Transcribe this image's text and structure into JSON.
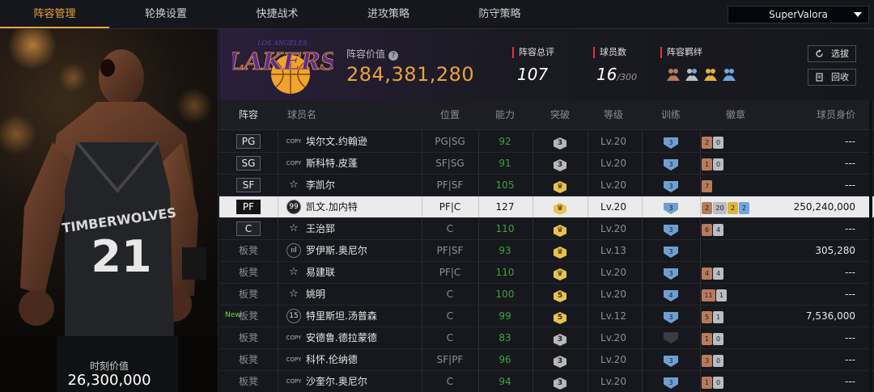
{
  "nav": {
    "tabs": [
      {
        "label": "阵容管理",
        "active": true
      },
      {
        "label": "轮换设置",
        "active": false
      },
      {
        "label": "快捷战术",
        "active": false
      },
      {
        "label": "进攻策略",
        "active": false
      },
      {
        "label": "防守策略",
        "active": false
      }
    ],
    "account": "SuperValora"
  },
  "player_panel": {
    "moment_label": "时刻价值",
    "moment_value": "26,300,000",
    "jersey_text": "TIMBERWOLVES",
    "jersey_number": "21"
  },
  "team": {
    "logo_text": "LAKERS",
    "logo_subtext": "LOS ANGELES",
    "value_label": "阵容价值",
    "value": "284,381,280",
    "rating_label": "阵容总评",
    "rating": "107",
    "count_label": "球员数",
    "count": "16",
    "count_max": "/300",
    "bond_label": "羁绊",
    "bond_label_full": "阵容羁绊",
    "buttons": {
      "select": "选拔",
      "recycle": "回收"
    }
  },
  "table": {
    "headers": {
      "lineup": "阵容",
      "name": "球员名",
      "position": "位置",
      "ability": "能力",
      "breakthrough": "突破",
      "level": "等级",
      "training": "训练",
      "badge": "徽章",
      "worth": "球员身价"
    },
    "rows": [
      {
        "slot": "PG",
        "card": "COPY",
        "name": "埃尔文.约翰逊",
        "pos": "PG|SG",
        "ability": "92",
        "bt": "3",
        "bt_color": "gray",
        "level": "Lv.20",
        "training": "3",
        "badges": [
          {
            "t": "2",
            "c": "bronze"
          },
          {
            "t": "0",
            "c": "silver"
          }
        ],
        "worth": "---",
        "new": ""
      },
      {
        "slot": "SG",
        "card": "COPY",
        "name": "斯科特.皮蓬",
        "pos": "SF|SG",
        "ability": "91",
        "bt": "3",
        "bt_color": "gray",
        "level": "Lv.20",
        "training": "3",
        "badges": [
          {
            "t": "1",
            "c": "bronze"
          },
          {
            "t": "0",
            "c": "silver"
          }
        ],
        "worth": "---",
        "new": ""
      },
      {
        "slot": "SF",
        "card": "☆",
        "name": "李凯尔",
        "pos": "PF|SF",
        "ability": "105",
        "bt": "♛",
        "bt_color": "gold",
        "level": "Lv.20",
        "training": "3",
        "badges": [
          {
            "t": "7",
            "c": "bronze"
          }
        ],
        "worth": "---",
        "new": ""
      },
      {
        "slot": "PF",
        "card": "99",
        "name": "凯文.加内特",
        "pos": "PF|C",
        "ability": "127",
        "bt": "♛",
        "bt_color": "gold",
        "level": "Lv.20",
        "training": "3",
        "badges": [
          {
            "t": "2",
            "c": "bronze"
          },
          {
            "t": "20",
            "c": "silver"
          },
          {
            "t": "2",
            "c": "gold"
          },
          {
            "t": "2",
            "c": "blue"
          }
        ],
        "worth": "250,240,000",
        "new": ""
      },
      {
        "slot": "C",
        "card": "☆",
        "name": "王治郅",
        "pos": "C",
        "ability": "110",
        "bt": "♛",
        "bt_color": "gold",
        "level": "Lv.20",
        "training": "3",
        "badges": [
          {
            "t": "6",
            "c": "bronze"
          },
          {
            "t": "4",
            "c": "silver"
          }
        ],
        "worth": "---",
        "new": ""
      },
      {
        "slot": "板凳",
        "card": "ııl",
        "name": "罗伊斯.奥尼尔",
        "pos": "PF|SF",
        "ability": "93",
        "bt": "♛",
        "bt_color": "gold",
        "level": "Lv.13",
        "training": "3",
        "badges": [],
        "worth": "305,280",
        "new": ""
      },
      {
        "slot": "板凳",
        "card": "☆",
        "name": "易建联",
        "pos": "PF|C",
        "ability": "110",
        "bt": "♛",
        "bt_color": "gold",
        "level": "Lv.20",
        "training": "3",
        "badges": [
          {
            "t": "4",
            "c": "bronze"
          },
          {
            "t": "4",
            "c": "silver"
          }
        ],
        "worth": "---",
        "new": ""
      },
      {
        "slot": "板凳",
        "card": "☆",
        "name": "姚明",
        "pos": "C",
        "ability": "100",
        "bt": "5",
        "bt_color": "gold",
        "level": "Lv.20",
        "training": "4",
        "badges": [
          {
            "t": "11",
            "c": "bronze"
          },
          {
            "t": "1",
            "c": "silver"
          }
        ],
        "worth": "---",
        "new": ""
      },
      {
        "slot": "板凳",
        "card": "15",
        "name": "特里斯坦.汤普森",
        "pos": "C",
        "ability": "99",
        "bt": "5",
        "bt_color": "gold",
        "level": "Lv.12",
        "training": "3",
        "badges": [
          {
            "t": "5",
            "c": "bronze"
          },
          {
            "t": "1",
            "c": "silver"
          }
        ],
        "worth": "7,536,000",
        "new": "New"
      },
      {
        "slot": "板凳",
        "card": "COPY",
        "name": "安德鲁.德拉蒙德",
        "pos": "C",
        "ability": "83",
        "bt": "3",
        "bt_color": "gray",
        "level": "Lv.20",
        "training": "",
        "badges": [
          {
            "t": "1",
            "c": "bronze"
          },
          {
            "t": "0",
            "c": "silver"
          }
        ],
        "worth": "---",
        "new": ""
      },
      {
        "slot": "板凳",
        "card": "COPY",
        "name": "科怀.伦纳德",
        "pos": "SF|PF",
        "ability": "96",
        "bt": "3",
        "bt_color": "gray",
        "level": "Lv.20",
        "training": "3",
        "badges": [
          {
            "t": "3",
            "c": "bronze"
          },
          {
            "t": "0",
            "c": "silver"
          }
        ],
        "worth": "---",
        "new": ""
      },
      {
        "slot": "板凳",
        "card": "COPY",
        "name": "沙奎尔.奥尼尔",
        "pos": "C",
        "ability": "94",
        "bt": "3",
        "bt_color": "gray",
        "level": "Lv.20",
        "training": "3",
        "badges": [
          {
            "t": "1",
            "c": "bronze"
          },
          {
            "t": "0",
            "c": "silver"
          }
        ],
        "worth": "---",
        "new": ""
      }
    ]
  },
  "colors": {
    "accent": "#e8a33c",
    "green": "#3ea33e",
    "red_marker": "#d83a3a"
  }
}
